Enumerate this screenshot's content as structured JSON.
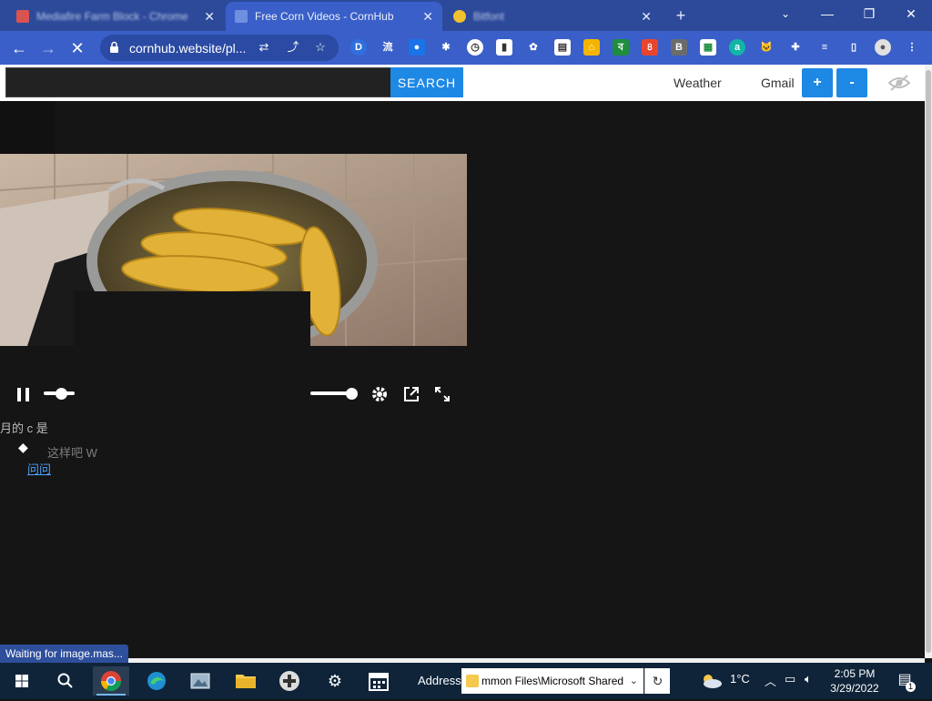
{
  "browser": {
    "tabs": [
      {
        "title": "Mediafire Farm Block - Chrome",
        "active": false
      },
      {
        "title": "Free Corn Videos - CornHub",
        "active": true
      },
      {
        "title": "Bitfont",
        "active": false
      }
    ],
    "url": "cornhub.website/pl...",
    "window_controls": {
      "minimize": "—",
      "maximize": "❐",
      "close": "✕"
    }
  },
  "site": {
    "search_label": "SEARCH",
    "search_value": "",
    "links": {
      "weather": "Weather",
      "gmail": "Gmail"
    },
    "plus_label": "+",
    "minus_label": "-"
  },
  "player": {
    "state": "playing",
    "progress_fraction": 0.55,
    "volume_fraction": 0.9
  },
  "garbled_text": {
    "line1": "月的   c   是",
    "line2": "这样吧   W",
    "link": "问问"
  },
  "status_bar": "Waiting for image.mas...",
  "taskbar": {
    "address_label": "Address",
    "address_value": "mmon Files\\Microsoft Shared",
    "temperature": "1°C",
    "time": "2:05 PM",
    "date": "3/29/2022",
    "notification_count": "1"
  },
  "colors": {
    "chrome_frame": "#2d4a9a",
    "chrome_toolbar": "#3a5fc8",
    "page_bg": "#151515",
    "accent_button": "#1e88e5",
    "taskbar": "#0f2439"
  }
}
